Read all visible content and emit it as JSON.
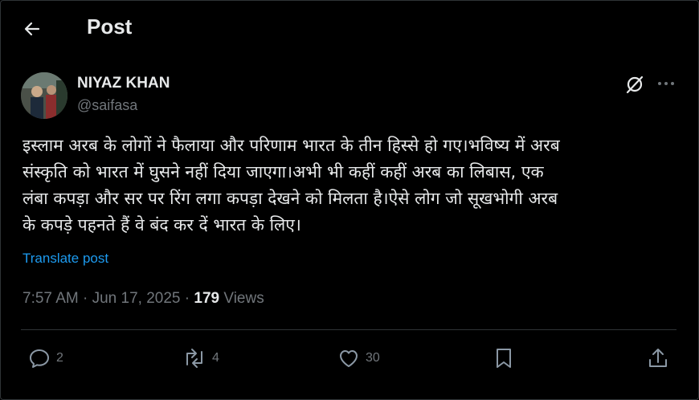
{
  "header": {
    "title": "Post"
  },
  "author": {
    "name": "NIYAZ KHAN",
    "handle": "@saifasa"
  },
  "post": {
    "text": "इस्लाम अरब के लोगों ने फैलाया और परिणाम भारत के तीन हिस्से हो गए।भविष्य में अरब\nसंस्कृति को भारत में घुसने नहीं दिया जाएगा।अभी भी कहीं कहीं अरब का लिबास, एक\nलंबा कपड़ा और सर पर रिंग लगा कपड़ा देखने को मिलता है।ऐसे लोग जो सूखभोगी अरब\nके कपड़े पहनते हैं वे बंद कर दें भारत के लिए।",
    "translate_label": "Translate post"
  },
  "meta": {
    "time": "7:57 AM",
    "separator": "·",
    "date": "Jun 17, 2025",
    "views_count": "179",
    "views_label": "Views"
  },
  "actions": {
    "replies": "2",
    "reposts": "4",
    "likes": "30"
  },
  "colors": {
    "background": "#000000",
    "text": "#e7e9ea",
    "secondary": "#71767b",
    "link": "#1d9bf0",
    "border": "#2f3336"
  },
  "icons": [
    "back-arrow-icon",
    "grok-icon",
    "more-icon",
    "reply-icon",
    "repost-icon",
    "like-icon",
    "bookmark-icon",
    "share-icon"
  ]
}
